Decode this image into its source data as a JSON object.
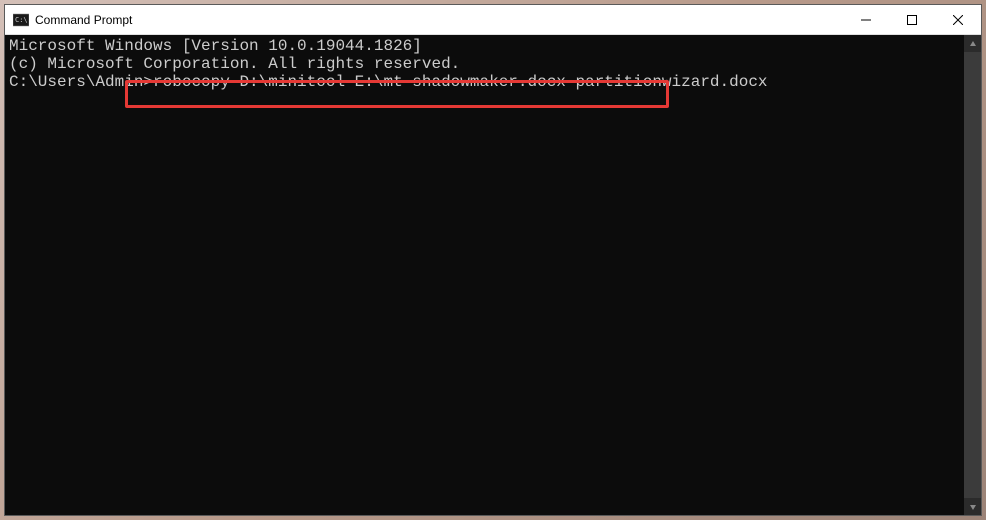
{
  "window": {
    "title": "Command Prompt"
  },
  "terminal": {
    "line1": "Microsoft Windows [Version 10.0.19044.1826]",
    "line2": "(c) Microsoft Corporation. All rights reserved.",
    "blank": "",
    "prompt_prefix": "C:\\Users\\Admin>",
    "command": "robocopy D:\\minitool E:\\mt shadowmaker.docx partitionwizard.docx"
  }
}
